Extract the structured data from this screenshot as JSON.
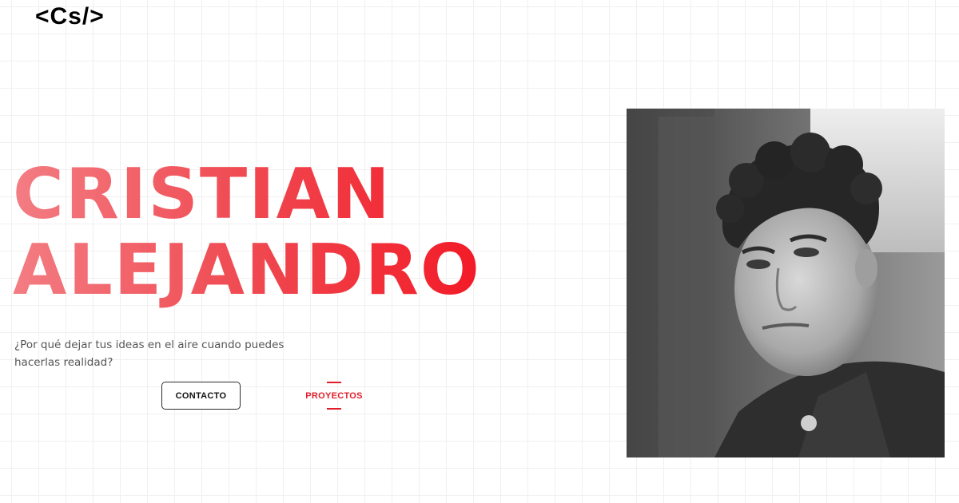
{
  "brand": {
    "logo_text": "<Cs/>"
  },
  "hero": {
    "name_line1": "CRISTIAN",
    "name_line2": "ALEJANDRO",
    "tagline": "¿Por qué dejar tus ideas en el aire cuando puedes hacerlas realidad?"
  },
  "buttons": {
    "contacto_label": "CONTACTO",
    "proyectos_label": "PROYECTOS"
  },
  "colors": {
    "accent": "#e11d2a",
    "name_gradient_start": "#f37d83",
    "name_gradient_end": "#f3121f"
  },
  "photo": {
    "style": "grayscale portrait"
  }
}
